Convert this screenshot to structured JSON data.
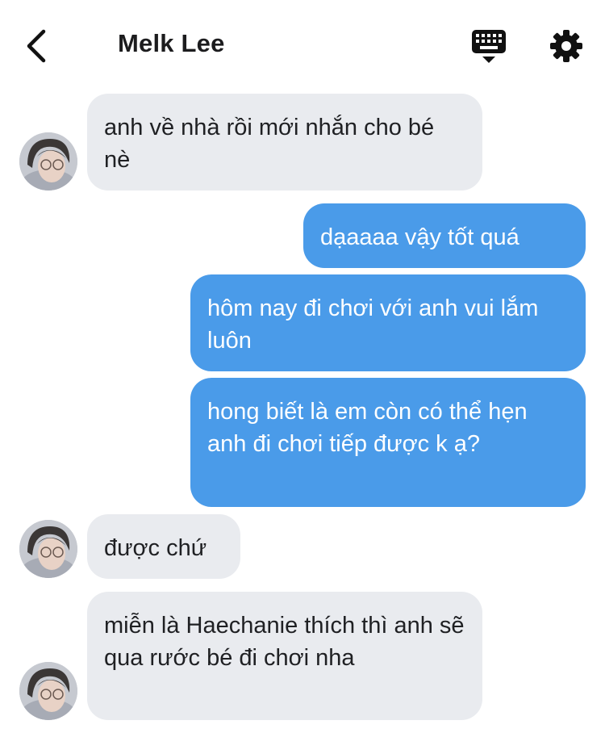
{
  "header": {
    "contact_name": "Melk Lee",
    "back_icon": "chevron-left-icon",
    "keyboard_icon": "keyboard-icon",
    "settings_icon": "gear-icon"
  },
  "colors": {
    "incoming_bubble": "#e9ebef",
    "outgoing_bubble": "#4a9be9",
    "header_text": "#1c1c1e"
  },
  "messages": [
    {
      "direction": "incoming",
      "text": "anh về nhà rồi mới nhắn cho bé nè",
      "avatar": true
    },
    {
      "direction": "outgoing",
      "text": "dạaaaa vậy tốt quá"
    },
    {
      "direction": "outgoing",
      "text": "hôm nay đi chơi với anh vui lắm luôn"
    },
    {
      "direction": "outgoing",
      "text": "hong biết là em còn có thể hẹn anh đi chơi tiếp được k ạ?"
    },
    {
      "direction": "incoming",
      "text": "được chứ",
      "avatar": true
    },
    {
      "direction": "incoming",
      "text": "miễn là Haechanie thích thì anh sẽ qua rước bé đi chơi nha",
      "avatar": true
    }
  ]
}
